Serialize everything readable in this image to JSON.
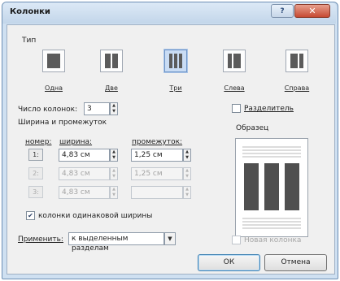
{
  "window": {
    "title": "Колонки",
    "help_label": "?",
    "close_label": "✕"
  },
  "type_section": {
    "label": "Тип",
    "presets": [
      {
        "label": "Одна",
        "icon": "one-column-icon",
        "selected": false
      },
      {
        "label": "Две",
        "icon": "two-columns-icon",
        "selected": false
      },
      {
        "label": "Три",
        "icon": "three-columns-icon",
        "selected": true
      },
      {
        "label": "Слева",
        "icon": "left-column-icon",
        "selected": false
      },
      {
        "label": "Справа",
        "icon": "right-column-icon",
        "selected": false
      }
    ]
  },
  "column_count": {
    "label": "Число колонок:",
    "value": "3"
  },
  "separator": {
    "label": "Разделитель",
    "checked": false
  },
  "width_spacing": {
    "label": "Ширина и промежуток",
    "headers": {
      "number": "номер:",
      "width": "ширина:",
      "spacing": "промежуток:"
    },
    "rows": [
      {
        "number": "1:",
        "width": "4,83 см",
        "spacing": "1,25 см"
      },
      {
        "number": "2:",
        "width": "4,83 см",
        "spacing": "1,25 см"
      },
      {
        "number": "3:",
        "width": "4,83 см",
        "spacing": ""
      }
    ]
  },
  "equal_width": {
    "label": "колонки одинаковой ширины",
    "checked": true
  },
  "preview": {
    "label": "Образец"
  },
  "apply": {
    "label": "Применить:",
    "value": "к выделенным разделам"
  },
  "new_column": {
    "label": "Новая колонка",
    "checked": false
  },
  "buttons": {
    "ok": "ОК",
    "cancel": "Отмена"
  },
  "colors": {
    "accent": "#6f95c7",
    "close": "#c64a32"
  }
}
